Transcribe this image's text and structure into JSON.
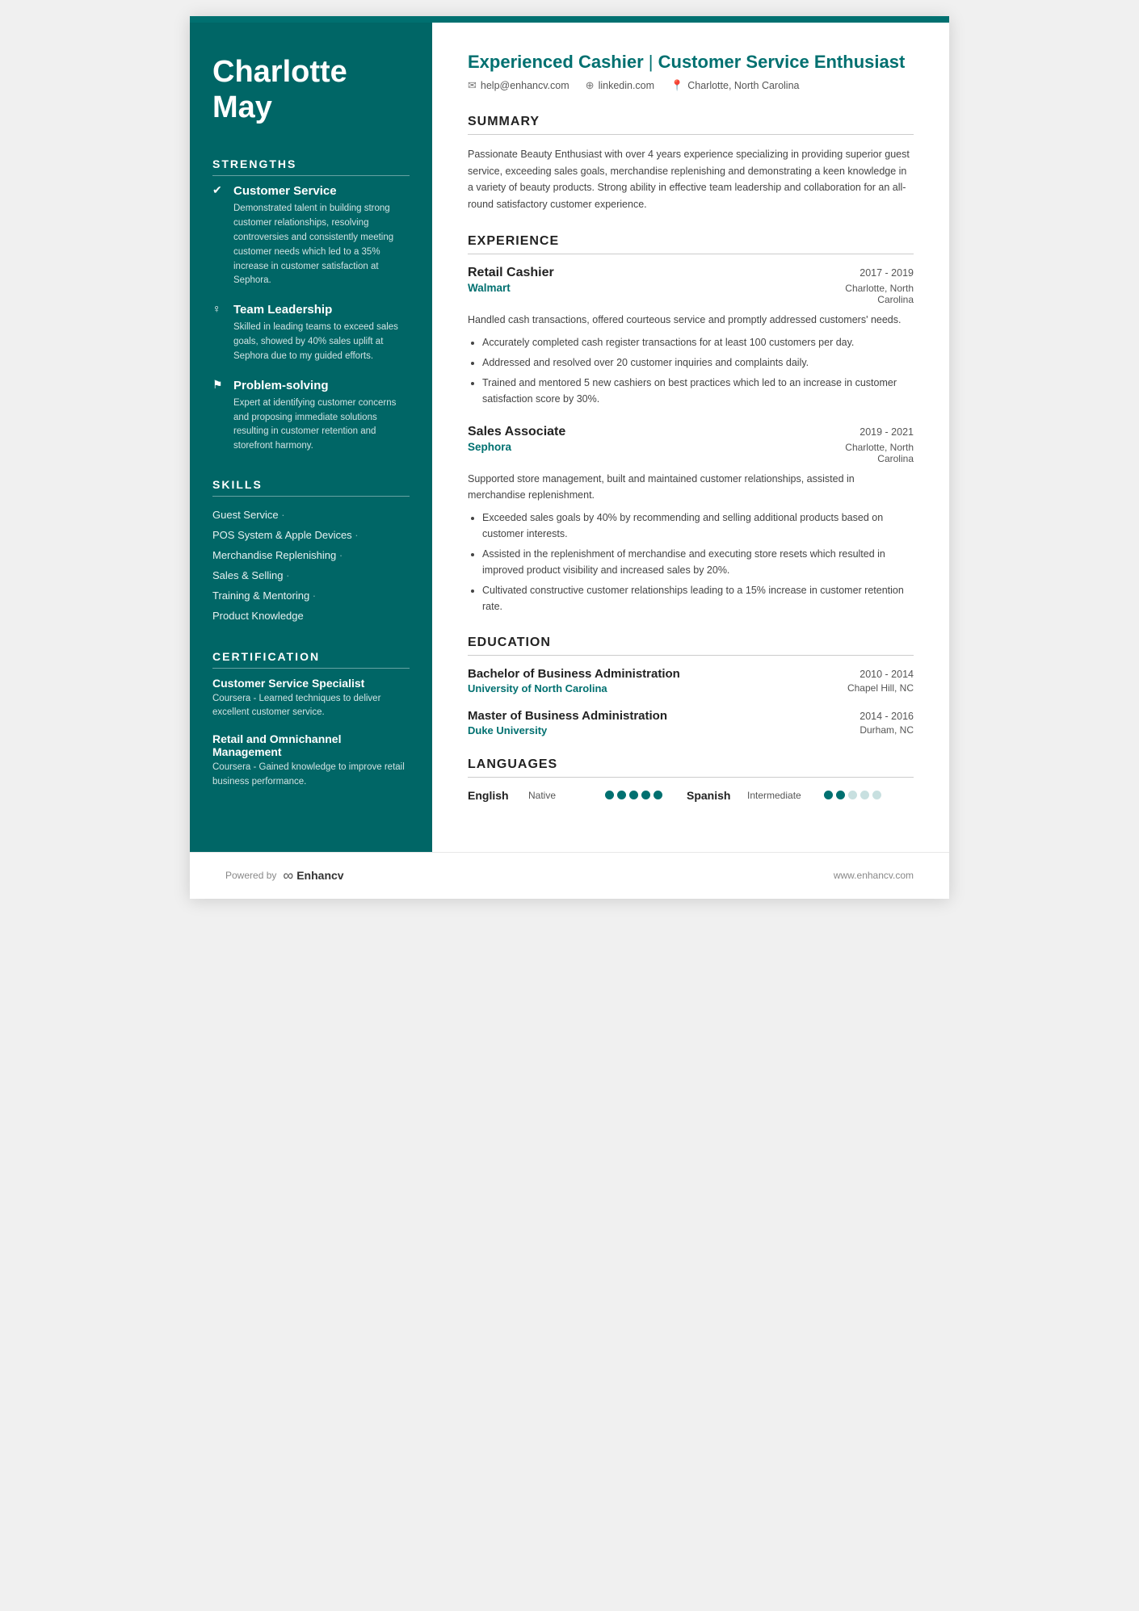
{
  "sidebar": {
    "name_line1": "Charlotte",
    "name_line2": "May",
    "strengths_title": "STRENGTHS",
    "strengths": [
      {
        "icon": "✔",
        "title": "Customer Service",
        "desc": "Demonstrated talent in building strong customer relationships, resolving controversies and consistently meeting customer needs which led to a 35% increase in customer satisfaction at Sephora."
      },
      {
        "icon": "♀",
        "title": "Team Leadership",
        "desc": "Skilled in leading teams to exceed sales goals, showed by 40% sales uplift at Sephora due to my guided efforts."
      },
      {
        "icon": "⚑",
        "title": "Problem-solving",
        "desc": "Expert at identifying customer concerns and proposing immediate solutions resulting in customer retention and storefront harmony."
      }
    ],
    "skills_title": "SKILLS",
    "skills": [
      "Guest Service",
      "POS System & Apple Devices",
      "Merchandise Replenishing",
      "Sales & Selling",
      "Training & Mentoring",
      "Product Knowledge"
    ],
    "certification_title": "CERTIFICATION",
    "certifications": [
      {
        "title": "Customer Service Specialist",
        "desc": "Coursera - Learned techniques to deliver excellent customer service."
      },
      {
        "title": "Retail and Omnichannel Management",
        "desc": "Coursera - Gained knowledge to improve retail business performance."
      }
    ]
  },
  "main": {
    "headline": "Experienced Cashier | Customer Service Enthusiast",
    "headline_part1": "Experienced Cashier",
    "headline_sep": " | ",
    "headline_part2": "Customer Service Enthusiast",
    "contact": {
      "email": "help@enhancv.com",
      "linkedin": "linkedin.com",
      "location": "Charlotte, North Carolina"
    },
    "summary_title": "SUMMARY",
    "summary_text": "Passionate Beauty Enthusiast with over 4 years experience specializing in providing superior guest service, exceeding sales goals, merchandise replenishing and demonstrating a keen knowledge in a variety of beauty products. Strong ability in effective team leadership and collaboration for an all-round satisfactory customer experience.",
    "experience_title": "EXPERIENCE",
    "experience": [
      {
        "job_title": "Retail Cashier",
        "dates": "2017 - 2019",
        "company": "Walmart",
        "location": "Charlotte, North\nCarolina",
        "summary": "Handled cash transactions, offered courteous service and promptly addressed customers' needs.",
        "bullets": [
          "Accurately completed cash register transactions for at least 100 customers per day.",
          "Addressed and resolved over 20 customer inquiries and complaints daily.",
          "Trained and mentored 5 new cashiers on best practices which led to an increase in customer satisfaction score by 30%."
        ]
      },
      {
        "job_title": "Sales Associate",
        "dates": "2019 - 2021",
        "company": "Sephora",
        "location": "Charlotte, North\nCarolina",
        "summary": "Supported store management, built and maintained customer relationships, assisted in merchandise replenishment.",
        "bullets": [
          "Exceeded sales goals by 40% by recommending and selling additional products based on customer interests.",
          "Assisted in the replenishment of merchandise and executing store resets which resulted in improved product visibility and increased sales by 20%.",
          "Cultivated constructive customer relationships leading to a 15% increase in customer retention rate."
        ]
      }
    ],
    "education_title": "EDUCATION",
    "education": [
      {
        "degree": "Bachelor of Business Administration",
        "dates": "2010 - 2014",
        "school": "University of North Carolina",
        "location": "Chapel Hill, NC"
      },
      {
        "degree": "Master of Business Administration",
        "dates": "2014 - 2016",
        "school": "Duke University",
        "location": "Durham, NC"
      }
    ],
    "languages_title": "LANGUAGES",
    "languages": [
      {
        "name": "English",
        "level": "Native",
        "filled": 5,
        "total": 5
      },
      {
        "name": "Spanish",
        "level": "Intermediate",
        "filled": 2,
        "total": 5
      }
    ]
  },
  "footer": {
    "powered_by": "Powered by",
    "brand": "Enhancv",
    "website": "www.enhancv.com"
  }
}
